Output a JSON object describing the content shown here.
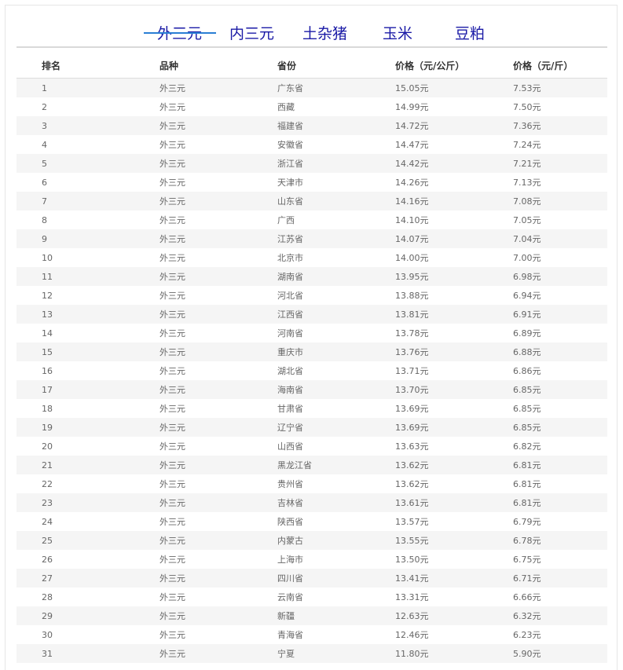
{
  "tabs": [
    "外三元",
    "内三元",
    "土杂猪",
    "玉米",
    "豆粕"
  ],
  "table": {
    "headers": [
      "排名",
      "品种",
      "省份",
      "价格（元/公斤）",
      "价格（元/斤）"
    ],
    "rows": [
      [
        "1",
        "外三元",
        "广东省",
        "15.05元",
        "7.53元"
      ],
      [
        "2",
        "外三元",
        "西藏",
        "14.99元",
        "7.50元"
      ],
      [
        "3",
        "外三元",
        "福建省",
        "14.72元",
        "7.36元"
      ],
      [
        "4",
        "外三元",
        "安徽省",
        "14.47元",
        "7.24元"
      ],
      [
        "5",
        "外三元",
        "浙江省",
        "14.42元",
        "7.21元"
      ],
      [
        "6",
        "外三元",
        "天津市",
        "14.26元",
        "7.13元"
      ],
      [
        "7",
        "外三元",
        "山东省",
        "14.16元",
        "7.08元"
      ],
      [
        "8",
        "外三元",
        "广西",
        "14.10元",
        "7.05元"
      ],
      [
        "9",
        "外三元",
        "江苏省",
        "14.07元",
        "7.04元"
      ],
      [
        "10",
        "外三元",
        "北京市",
        "14.00元",
        "7.00元"
      ],
      [
        "11",
        "外三元",
        "湖南省",
        "13.95元",
        "6.98元"
      ],
      [
        "12",
        "外三元",
        "河北省",
        "13.88元",
        "6.94元"
      ],
      [
        "13",
        "外三元",
        "江西省",
        "13.81元",
        "6.91元"
      ],
      [
        "14",
        "外三元",
        "河南省",
        "13.78元",
        "6.89元"
      ],
      [
        "15",
        "外三元",
        "重庆市",
        "13.76元",
        "6.88元"
      ],
      [
        "16",
        "外三元",
        "湖北省",
        "13.71元",
        "6.86元"
      ],
      [
        "17",
        "外三元",
        "海南省",
        "13.70元",
        "6.85元"
      ],
      [
        "18",
        "外三元",
        "甘肃省",
        "13.69元",
        "6.85元"
      ],
      [
        "19",
        "外三元",
        "辽宁省",
        "13.69元",
        "6.85元"
      ],
      [
        "20",
        "外三元",
        "山西省",
        "13.63元",
        "6.82元"
      ],
      [
        "21",
        "外三元",
        "黑龙江省",
        "13.62元",
        "6.81元"
      ],
      [
        "22",
        "外三元",
        "贵州省",
        "13.62元",
        "6.81元"
      ],
      [
        "23",
        "外三元",
        "吉林省",
        "13.61元",
        "6.81元"
      ],
      [
        "24",
        "外三元",
        "陕西省",
        "13.57元",
        "6.79元"
      ],
      [
        "25",
        "外三元",
        "内蒙古",
        "13.55元",
        "6.78元"
      ],
      [
        "26",
        "外三元",
        "上海市",
        "13.50元",
        "6.75元"
      ],
      [
        "27",
        "外三元",
        "四川省",
        "13.41元",
        "6.71元"
      ],
      [
        "28",
        "外三元",
        "云南省",
        "13.31元",
        "6.66元"
      ],
      [
        "29",
        "外三元",
        "新疆",
        "12.63元",
        "6.32元"
      ],
      [
        "30",
        "外三元",
        "青海省",
        "12.46元",
        "6.23元"
      ],
      [
        "31",
        "外三元",
        "宁夏",
        "11.80元",
        "5.90元"
      ]
    ]
  },
  "colors": {
    "tab_text": "#1a1aa6",
    "tab_underline": "#2a7fd4",
    "stripe": "#f5f5f5"
  }
}
